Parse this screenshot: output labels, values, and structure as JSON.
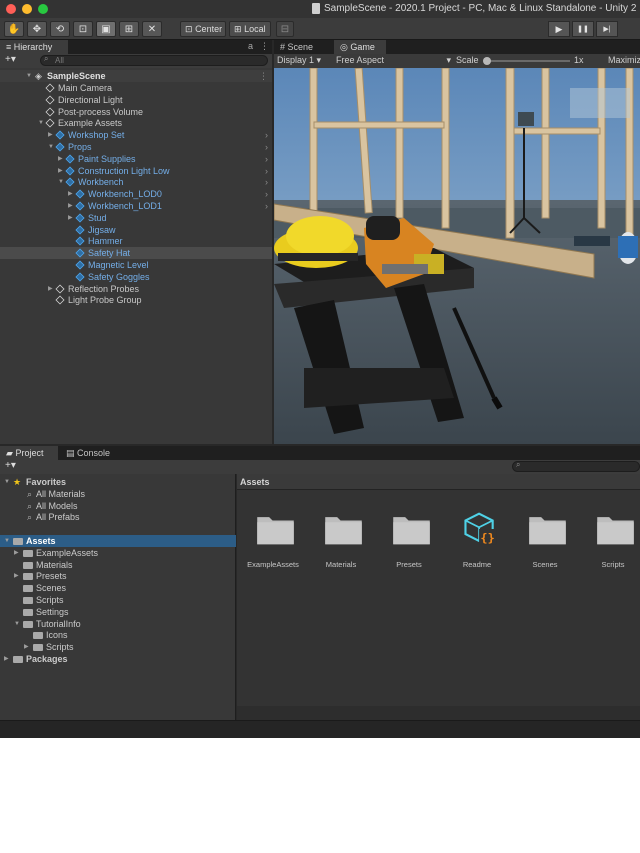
{
  "window": {
    "title": "SampleScene - 2020.1 Project - PC, Mac & Linux Standalone - Unity 2"
  },
  "toolbar": {
    "tools": [
      {
        "icon": "hand-icon",
        "glyph": "✋"
      },
      {
        "icon": "move-icon",
        "glyph": "✥"
      },
      {
        "icon": "rotate-icon",
        "glyph": "⟲"
      },
      {
        "icon": "scale-icon",
        "glyph": "⊡"
      },
      {
        "icon": "rect-tool-icon",
        "glyph": "▣"
      },
      {
        "icon": "transform-icon",
        "glyph": "⊞"
      },
      {
        "icon": "custom-tool-icon",
        "glyph": "✕"
      }
    ],
    "pivot_label": "Center",
    "space_label": "Local",
    "play_glyph": "▶",
    "pause_glyph": "❚❚",
    "step_glyph": "▶|"
  },
  "hierarchy": {
    "tab_label": "Hierarchy",
    "add_label": "+▾",
    "search_placeholder": "All",
    "scene_name": "SampleScene",
    "items": [
      {
        "label": "Main Camera",
        "depth": 1,
        "arrow": "",
        "blue": false
      },
      {
        "label": "Directional Light",
        "depth": 1,
        "arrow": "",
        "blue": false
      },
      {
        "label": "Post-process Volume",
        "depth": 1,
        "arrow": "",
        "blue": false
      },
      {
        "label": "Example Assets",
        "depth": 1,
        "arrow": "▼",
        "blue": false
      },
      {
        "label": "Workshop Set",
        "depth": 2,
        "arrow": "▶",
        "blue": true,
        "chev": true
      },
      {
        "label": "Props",
        "depth": 2,
        "arrow": "▼",
        "blue": true,
        "chev": true
      },
      {
        "label": "Paint Supplies",
        "depth": 3,
        "arrow": "▶",
        "blue": true,
        "chev": true
      },
      {
        "label": "Construction Light Low",
        "depth": 3,
        "arrow": "▶",
        "blue": true,
        "chev": true
      },
      {
        "label": "Workbench",
        "depth": 3,
        "arrow": "▼",
        "blue": true,
        "chev": true
      },
      {
        "label": "Workbench_LOD0",
        "depth": 4,
        "arrow": "▶",
        "blue": true,
        "chev": true
      },
      {
        "label": "Workbench_LOD1",
        "depth": 4,
        "arrow": "▶",
        "blue": true,
        "chev": true
      },
      {
        "label": "Stud",
        "depth": 4,
        "arrow": "▶",
        "blue": true,
        "chev": false
      },
      {
        "label": "Jigsaw",
        "depth": 4,
        "arrow": "",
        "blue": true,
        "chev": false
      },
      {
        "label": "Hammer",
        "depth": 4,
        "arrow": "",
        "blue": true,
        "chev": false
      },
      {
        "label": "Safety Hat",
        "depth": 4,
        "arrow": "",
        "blue": true,
        "chev": false,
        "selected": true
      },
      {
        "label": "Magnetic Level",
        "depth": 4,
        "arrow": "",
        "blue": true,
        "chev": false
      },
      {
        "label": "Safety Goggles",
        "depth": 4,
        "arrow": "",
        "blue": true,
        "chev": false
      },
      {
        "label": "Reflection Probes",
        "depth": 2,
        "arrow": "▶",
        "blue": false
      },
      {
        "label": "Light Probe Group",
        "depth": 2,
        "arrow": "",
        "blue": false
      }
    ]
  },
  "view_tabs": {
    "scene_label": "Scene",
    "game_label": "Game"
  },
  "game_bar": {
    "display": "Display 1",
    "aspect": "Free Aspect",
    "scale_label": "Scale",
    "scale_value": "1x",
    "maximize": "Maximiz"
  },
  "bottom_tabs": {
    "project_label": "Project",
    "console_label": "Console"
  },
  "project_tree": {
    "add_label": "+▾",
    "items": [
      {
        "label": "Favorites",
        "depth": 0,
        "arrow": "▼",
        "type": "star",
        "bold": true
      },
      {
        "label": "All Materials",
        "depth": 1,
        "arrow": "",
        "type": "search"
      },
      {
        "label": "All Models",
        "depth": 1,
        "arrow": "",
        "type": "search"
      },
      {
        "label": "All Prefabs",
        "depth": 1,
        "arrow": "",
        "type": "search"
      },
      {
        "label": "",
        "depth": 0,
        "arrow": "",
        "type": "gap"
      },
      {
        "label": "Assets",
        "depth": 0,
        "arrow": "▼",
        "type": "folder",
        "bold": true,
        "selected": true
      },
      {
        "label": "ExampleAssets",
        "depth": 1,
        "arrow": "▶",
        "type": "folder"
      },
      {
        "label": "Materials",
        "depth": 1,
        "arrow": "",
        "type": "folder"
      },
      {
        "label": "Presets",
        "depth": 1,
        "arrow": "▶",
        "type": "folder"
      },
      {
        "label": "Scenes",
        "depth": 1,
        "arrow": "",
        "type": "folder"
      },
      {
        "label": "Scripts",
        "depth": 1,
        "arrow": "",
        "type": "folder"
      },
      {
        "label": "Settings",
        "depth": 1,
        "arrow": "",
        "type": "folder"
      },
      {
        "label": "TutorialInfo",
        "depth": 1,
        "arrow": "▼",
        "type": "folder"
      },
      {
        "label": "Icons",
        "depth": 2,
        "arrow": "",
        "type": "folder"
      },
      {
        "label": "Scripts",
        "depth": 2,
        "arrow": "▶",
        "type": "folder"
      },
      {
        "label": "Packages",
        "depth": 0,
        "arrow": "▶",
        "type": "folder",
        "bold": true
      }
    ]
  },
  "assets_pane": {
    "header": "Assets",
    "items": [
      {
        "label": "ExampleAssets",
        "type": "folder"
      },
      {
        "label": "Materials",
        "type": "folder"
      },
      {
        "label": "Presets",
        "type": "folder"
      },
      {
        "label": "Readme",
        "type": "readme"
      },
      {
        "label": "Scenes",
        "type": "folder"
      },
      {
        "label": "Scripts",
        "type": "folder"
      }
    ]
  },
  "colors": {
    "selection": "#2c5d87",
    "prefab_blue": "#74aee8",
    "readme_cyan": "#4fd1e6",
    "readme_orange": "#f28a1e"
  }
}
